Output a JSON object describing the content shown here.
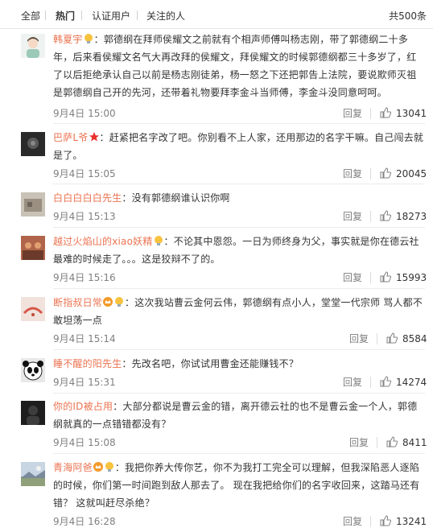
{
  "tabs": {
    "all": "全部",
    "hot": "热门",
    "verified": "认证用户",
    "following": "关注的人",
    "total": "共500条"
  },
  "actions": {
    "reply": "回复"
  },
  "comments": [
    {
      "user": "韩夏宇",
      "separator": "：",
      "text": "郭德纲在拜师侯耀文之前就有个相声师傅叫杨志刚，带了郭德纲二十多年，后来看侯耀文名气大再改拜的侯耀文，拜侯耀文的时候郭德纲都三十多岁了，红了以后拒绝承认自己以前是杨志刚徒弟，杨一怒之下还把郭告上法院，要说欺师灭祖是郭德纲自己开的先河，还带着礼物要拜李金斗当师傅，李金斗没同意呵呵。",
      "time": "9月4日 15:00",
      "likes": "13041",
      "badges": [
        "lightbulb-badge-icon"
      ]
    },
    {
      "user": "巴萨L爷",
      "separator": "：",
      "text": "赶紧把名字改了吧。你别看不上人家，还用那边的名字干嘛。自己闯去就是了。",
      "time": "9月4日 15:05",
      "likes": "20045",
      "badges": [
        "red-star-icon"
      ]
    },
    {
      "user": "白白白白白先生",
      "separator": "：",
      "text": "没有郭德纲谁认识你啊",
      "time": "9月4日 15:13",
      "likes": "18273",
      "badges": []
    },
    {
      "user": "越过火焰山的xiao妖精",
      "separator": "：",
      "text": "不论其中恩怨。一日为师终身为父，事实就是你在德云社最难的时候走了。。。这是狡辩不了的。",
      "time": "9月4日 15:16",
      "likes": "15993",
      "badges": [
        "lightbulb-badge-icon"
      ]
    },
    {
      "user": "断指叔日常",
      "separator": "：",
      "text": "这次我站曹云金何云伟，郭德纲有点小人，堂堂一代宗师 骂人都不敢坦荡一点",
      "time": "9月4日 15:14",
      "likes": "8584",
      "badges": [
        "vip-crown-icon",
        "lightbulb-badge-icon"
      ]
    },
    {
      "user": "睡不醒的阳先生",
      "separator": "：",
      "text": "先改名吧，你试试用曹金还能赚钱不？",
      "time": "9月4日 15:31",
      "likes": "14274",
      "badges": []
    },
    {
      "user": "你的ID被占用",
      "separator": "：",
      "text": "大部分都说是曹云金的错，离开德云社的也不是曹云金一个人，郭德纲就真的一点错错都没有？",
      "time": "9月4日 15:08",
      "likes": "8411",
      "badges": []
    },
    {
      "user": "青海阿爸",
      "separator": "：",
      "text": "我把你养大传你艺，你不为我打工完全可以理解，但我深陷恶人逐陷的时候，你们第一时间跑到敌人那去了。 现在我把给你们的名字收回来，这踏马还有错？ 这就叫赶尽杀绝？",
      "time": "9月4日 16:28",
      "likes": "13241",
      "badges": [
        "vip-crown-icon",
        "lightbulb-badge-icon"
      ]
    }
  ],
  "colors": {
    "username": "#eb7350",
    "text": "#333333",
    "muted": "#808080",
    "divider": "#ececec"
  }
}
